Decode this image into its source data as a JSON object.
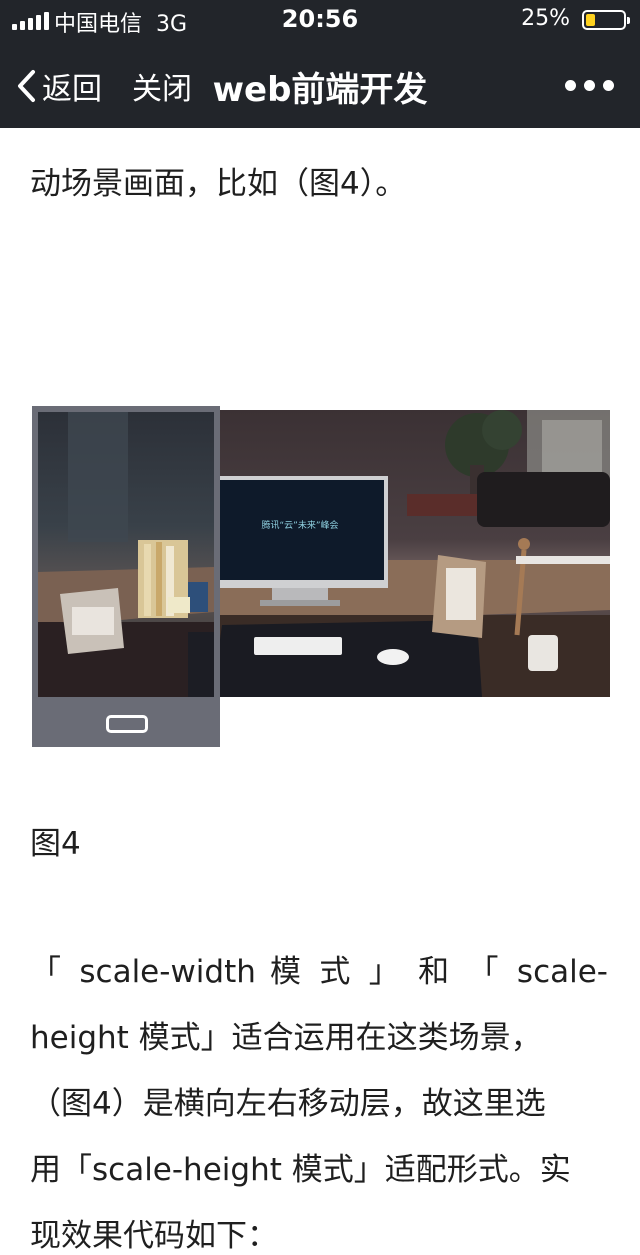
{
  "status": {
    "carrier": "中国电信",
    "network": "3G",
    "time": "20:56",
    "battery": "25%",
    "battery_level": 0.25,
    "battery_color": "#ffd21f"
  },
  "nav": {
    "back_label": "返回",
    "close_label": "关闭",
    "title": "web前端开发"
  },
  "article": {
    "line1": "动场景画面，比如（图4）。",
    "caption": "图4",
    "figure_headline": "腾讯“云”未来”峰会",
    "para": [
      "「 scale-width 模 式 」 和 「 scale-",
      "height 模式」适合运用在这类场景，",
      "（图4）是横向左右移动层，故这里选",
      "用「scale-height 模式」适配形式。实",
      "现效果代码如下："
    ]
  }
}
